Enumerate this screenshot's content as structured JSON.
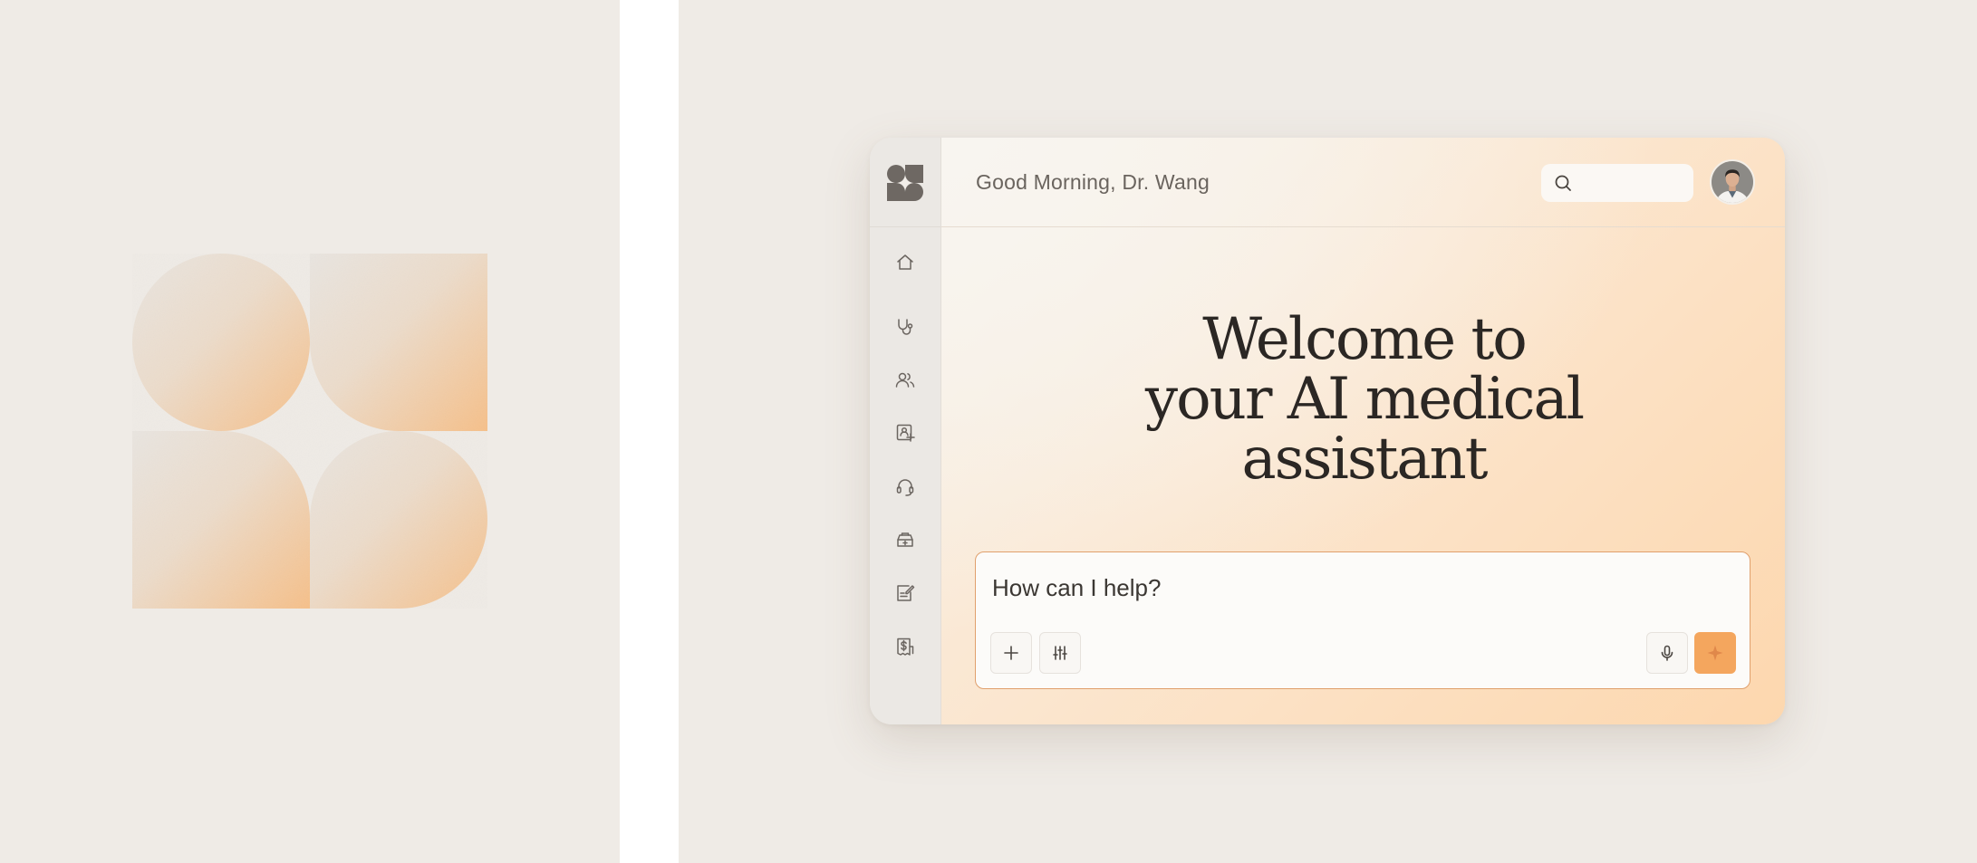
{
  "header": {
    "greeting": "Good Morning, Dr. Wang",
    "search_placeholder": "",
    "avatar_icon": "user-avatar"
  },
  "sidebar": {
    "logo_icon": "sparkle-logo-icon",
    "items": [
      {
        "name": "home",
        "icon": "home-icon"
      },
      {
        "name": "clinical",
        "icon": "stethoscope-icon"
      },
      {
        "name": "patients",
        "icon": "users-icon"
      },
      {
        "name": "patient-records",
        "icon": "id-card-icon"
      },
      {
        "name": "support",
        "icon": "headset-icon"
      },
      {
        "name": "medical-kit",
        "icon": "medical-kit-icon"
      },
      {
        "name": "notes",
        "icon": "edit-note-icon"
      },
      {
        "name": "billing",
        "icon": "billing-icon"
      }
    ]
  },
  "main": {
    "hero_lines": [
      "Welcome to",
      "your AI medical",
      "assistant"
    ]
  },
  "prompt": {
    "placeholder": "How can I help?",
    "buttons": [
      {
        "name": "add",
        "icon": "plus-icon"
      },
      {
        "name": "settings",
        "icon": "sliders-icon"
      },
      {
        "name": "voice",
        "icon": "microphone-icon"
      },
      {
        "name": "submit",
        "icon": "sparkle-icon"
      }
    ]
  },
  "colors": {
    "background": "#efebe6",
    "accent": "#f4a65e",
    "accent_border": "#e0a06d",
    "text_dark": "#2b2724"
  }
}
